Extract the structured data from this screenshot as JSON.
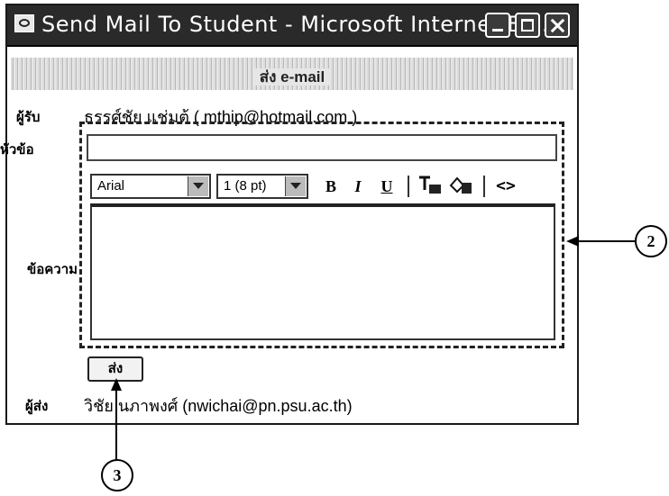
{
  "window": {
    "title": "Send Mail To Student - Microsoft Internet Ex..."
  },
  "header": {
    "title": "ส่ง e-mail"
  },
  "recipient": {
    "label": "ผู้รับ",
    "value": "ธรรศ์ชัย แช่มต้ ( mthip@hotmail.com )"
  },
  "subject": {
    "label": "หัวข้อ",
    "value": ""
  },
  "toolbar": {
    "font": "Arial",
    "size": "1 (8 pt)",
    "bold": "B",
    "italic": "I",
    "underline": "U",
    "source": "<>"
  },
  "message": {
    "label": "ข้อความ",
    "value": ""
  },
  "send_button": {
    "label": "ส่ง"
  },
  "sender": {
    "label": "ผู้ส่ง",
    "value": "วิชัย นภาพงศ์ (nwichai@pn.psu.ac.th)"
  },
  "callouts": [
    "2",
    "3"
  ]
}
